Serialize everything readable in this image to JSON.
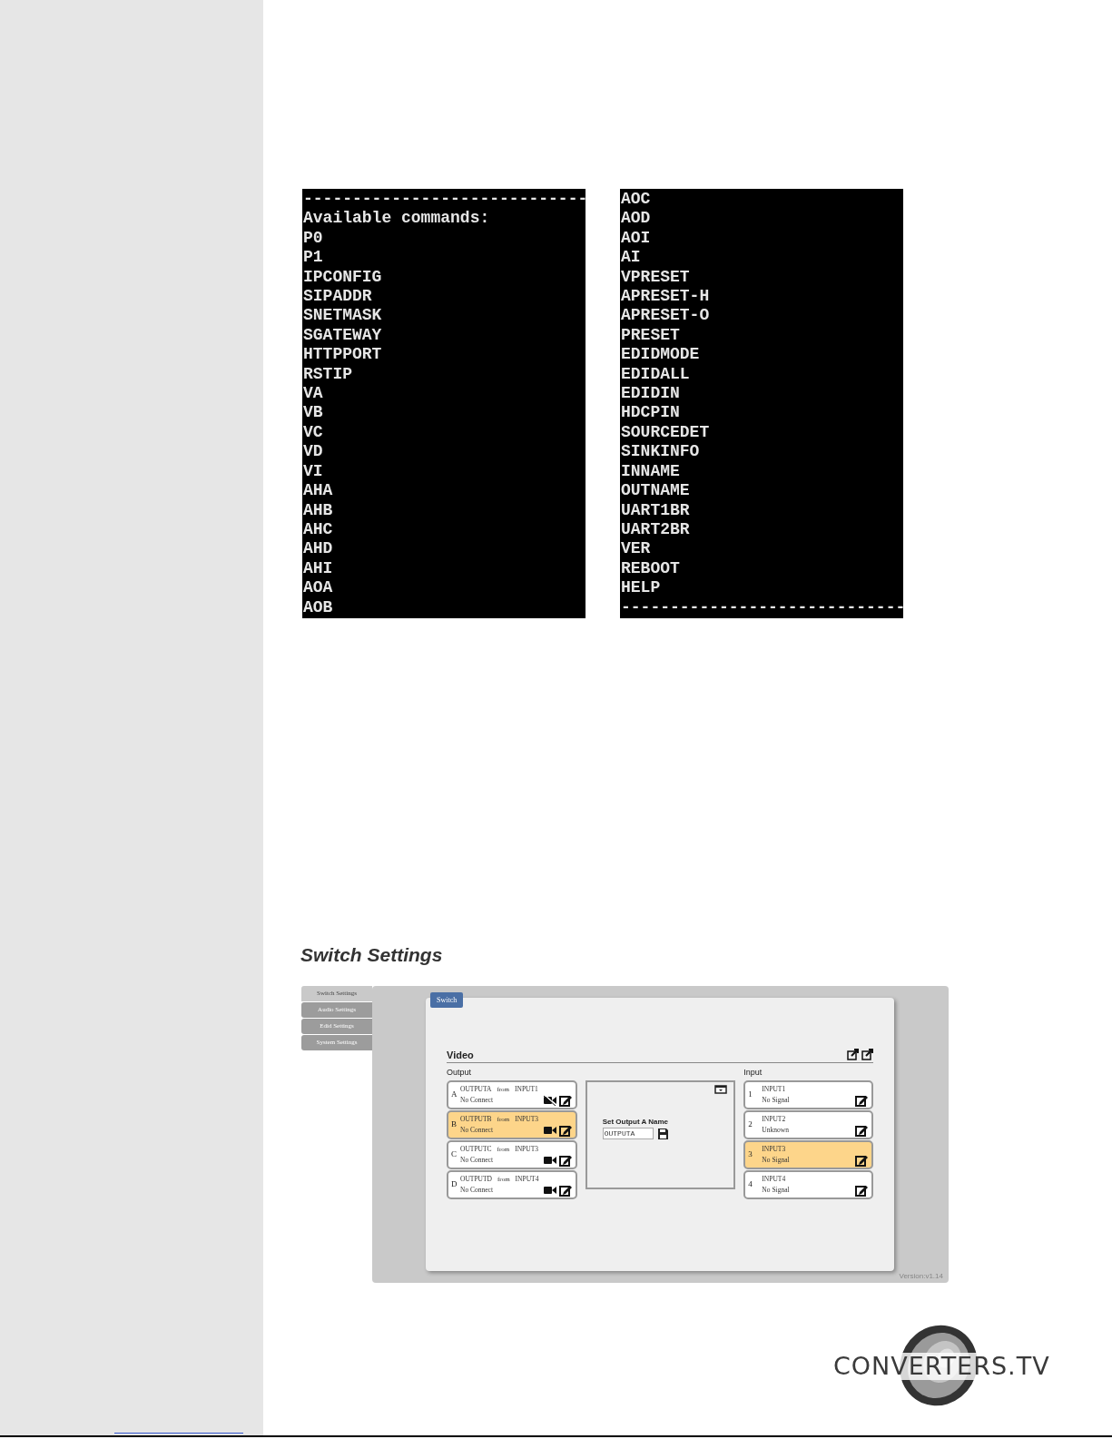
{
  "terminals": [
    {
      "lines": [
        "-----------------------------",
        "Available commands:",
        "P0",
        "P1",
        "IPCONFIG",
        "SIPADDR",
        "SNETMASK",
        "SGATEWAY",
        "HTTPPORT",
        "RSTIP",
        "VA",
        "VB",
        "VC",
        "VD",
        "VI",
        "AHA",
        "AHB",
        "AHC",
        "AHD",
        "AHI",
        "AOA",
        "AOB"
      ]
    },
    {
      "lines": [
        "AOC",
        "AOD",
        "AOI",
        "AI",
        "VPRESET",
        "APRESET-H",
        "APRESET-O",
        "PRESET",
        "EDIDMODE",
        "EDIDALL",
        "EDIDIN",
        "HDCPIN",
        "SOURCEDET",
        "SINKINFO",
        "INNAME",
        "OUTNAME",
        "UART1BR",
        "UART2BR",
        "VER",
        "REBOOT",
        "HELP",
        "-----------------------------"
      ]
    }
  ],
  "section_title": "Switch Settings",
  "web_ui": {
    "side_tabs": [
      {
        "label": "Switch Settings",
        "selected": true
      },
      {
        "label": "Audio Settings",
        "selected": false
      },
      {
        "label": "Edid Settings",
        "selected": false
      },
      {
        "label": "System Settings",
        "selected": false
      }
    ],
    "tab": {
      "label": "Switch",
      "selected": true
    },
    "section": "Video",
    "output_label": "Output",
    "outputs": [
      {
        "letter": "A",
        "name": "OUTPUTA",
        "from_label": "from",
        "source": "INPUT1",
        "status": "No Connect",
        "selected": false,
        "video_muted": true
      },
      {
        "letter": "B",
        "name": "OUTPUTB",
        "from_label": "from",
        "source": "INPUT3",
        "status": "No Connect",
        "selected": true,
        "video_muted": false
      },
      {
        "letter": "C",
        "name": "OUTPUTC",
        "from_label": "from",
        "source": "INPUT3",
        "status": "No Connect",
        "selected": false,
        "video_muted": false
      },
      {
        "letter": "D",
        "name": "OUTPUTD",
        "from_label": "from",
        "source": "INPUT4",
        "status": "No Connect",
        "selected": false,
        "video_muted": false
      }
    ],
    "name_editor": {
      "label": "Set Output A Name",
      "value": "OUTPUTA"
    },
    "input_label": "Input",
    "inputs": [
      {
        "number": "1",
        "name": "INPUT1",
        "status": "No Signal",
        "selected": false
      },
      {
        "number": "2",
        "name": "INPUT2",
        "status": "Unknown",
        "selected": false
      },
      {
        "number": "3",
        "name": "INPUT3",
        "status": "No Signal",
        "selected": true
      },
      {
        "number": "4",
        "name": "INPUT4",
        "status": "No Signal",
        "selected": false
      }
    ],
    "version": "Version:v1.14"
  },
  "logo": {
    "text": "CONVERTERS.TV"
  }
}
